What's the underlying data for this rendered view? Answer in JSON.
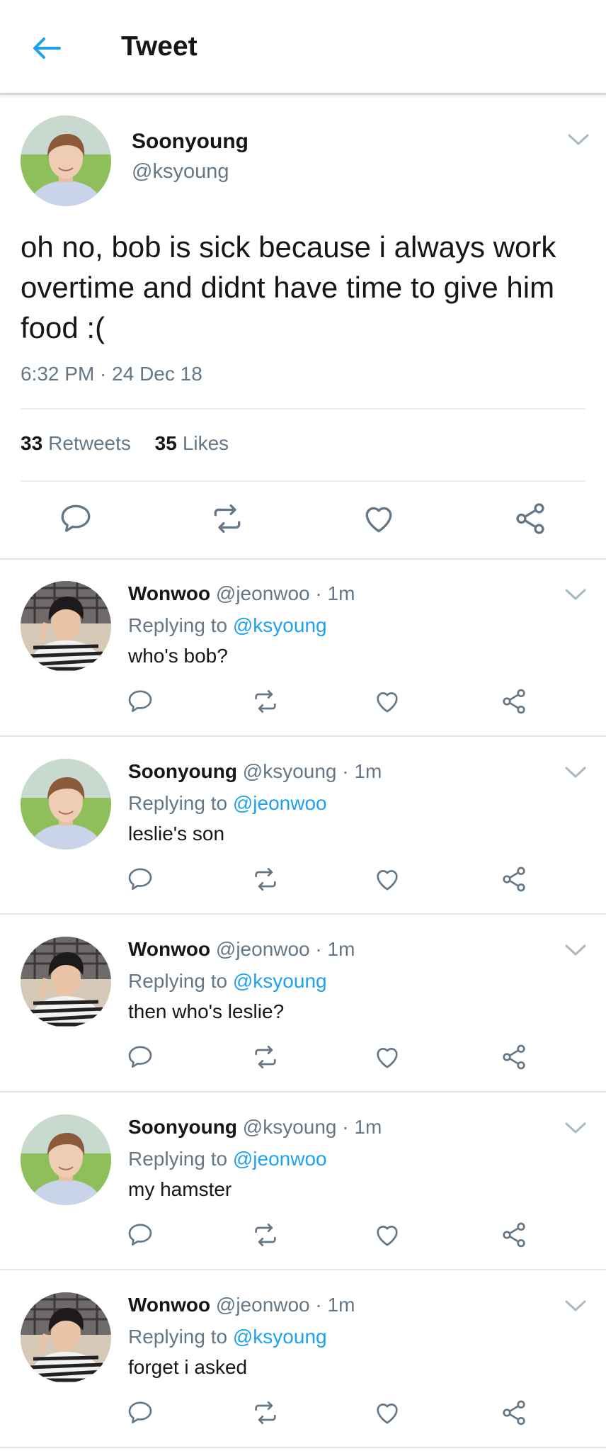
{
  "header": {
    "title": "Tweet",
    "back_icon": "arrow-left-icon"
  },
  "colors": {
    "accent": "#1da1f2",
    "secondary_text": "#657786",
    "primary_text": "#14171a",
    "divider": "#e1e8ed"
  },
  "main_tweet": {
    "name": "Soonyoung",
    "handle": "@ksyoung",
    "text": "oh no, bob is sick because i always work overtime and didnt have time to give him food :(",
    "time": "6:32 PM · 24 Dec 18",
    "retweets_count": "33",
    "retweets_label": "Retweets",
    "likes_count": "35",
    "likes_label": "Likes",
    "actions": [
      "reply-icon",
      "retweet-icon",
      "like-icon",
      "share-icon"
    ]
  },
  "replies": [
    {
      "name": "Wonwoo",
      "handle": "@jeonwoo",
      "dot": "·",
      "time": "1m",
      "replying_prefix": "Replying to",
      "replying_to": "@ksyoung",
      "text": "who's bob?"
    },
    {
      "name": "Soonyoung",
      "handle": "@ksyoung",
      "dot": "·",
      "time": "1m",
      "replying_prefix": "Replying to",
      "replying_to": "@jeonwoo",
      "text": "leslie's son"
    },
    {
      "name": "Wonwoo",
      "handle": "@jeonwoo",
      "dot": "·",
      "time": "1m",
      "replying_prefix": "Replying to",
      "replying_to": "@ksyoung",
      "text": "then who's leslie?"
    },
    {
      "name": "Soonyoung",
      "handle": "@ksyoung",
      "dot": "·",
      "time": "1m",
      "replying_prefix": "Replying to",
      "replying_to": "@jeonwoo",
      "text": "my hamster"
    },
    {
      "name": "Wonwoo",
      "handle": "@jeonwoo",
      "dot": "·",
      "time": "1m",
      "replying_prefix": "Replying to",
      "replying_to": "@ksyoung",
      "text": "forget i asked"
    }
  ]
}
